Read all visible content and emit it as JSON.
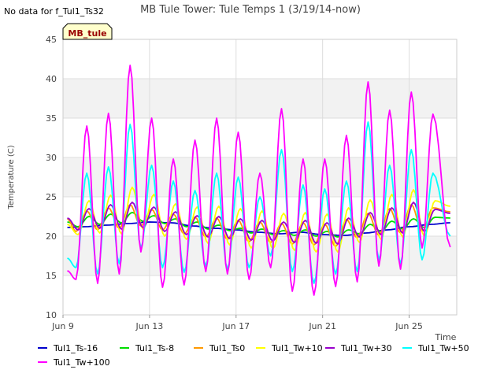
{
  "chart_data": {
    "type": "line",
    "title": "MB Tule Tower: Tule Temps 1 (3/19/14-now)",
    "no_data_note": "No data for f_Tul1_Ts32",
    "site_badge": "MB_tule",
    "xlabel": "Time",
    "ylabel": "Temperature (C)",
    "ylim": [
      10,
      45
    ],
    "yticks": [
      10,
      15,
      20,
      25,
      30,
      35,
      40,
      45
    ],
    "xlim": [
      9,
      27.2
    ],
    "xticks": [
      {
        "value": 9,
        "label": "Jun 9"
      },
      {
        "value": 13,
        "label": "Jun 13"
      },
      {
        "value": 17,
        "label": "Jun 17"
      },
      {
        "value": 21,
        "label": "Jun 21"
      },
      {
        "value": 25,
        "label": "Jun 25"
      }
    ],
    "grid": true,
    "legend": "bottom",
    "series": [
      {
        "name": "Tul1_Ts-16",
        "color": "#0000cc",
        "x": [
          9.2,
          10,
          11,
          12,
          13,
          14,
          15,
          16,
          17,
          18,
          19,
          20,
          21,
          22,
          23,
          24,
          25,
          26,
          26.9
        ],
        "y": [
          21.1,
          21.2,
          21.4,
          21.6,
          21.8,
          21.7,
          21.3,
          21.0,
          20.8,
          20.5,
          20.3,
          20.5,
          20.2,
          20.1,
          20.4,
          20.8,
          21.2,
          21.5,
          21.7
        ]
      },
      {
        "name": "Tul1_Ts-8",
        "color": "#00dd00",
        "x": [
          9.2,
          9.7,
          10.2,
          10.7,
          11.2,
          11.7,
          12.2,
          12.7,
          13.2,
          13.7,
          14.2,
          14.7,
          15.2,
          15.7,
          16.2,
          16.7,
          17.2,
          17.7,
          18.2,
          18.7,
          19.2,
          19.7,
          20.2,
          20.7,
          21.2,
          21.7,
          22.2,
          22.7,
          23.2,
          23.7,
          24.2,
          24.7,
          25.2,
          25.7,
          26.2,
          26.9
        ],
        "y": [
          21.8,
          21.2,
          22.5,
          21.5,
          22.8,
          21.7,
          23.0,
          21.9,
          22.6,
          21.6,
          22.2,
          21.2,
          21.8,
          20.9,
          21.4,
          20.7,
          21.0,
          20.4,
          20.9,
          20.2,
          20.7,
          20.1,
          20.8,
          20.0,
          20.6,
          19.9,
          20.8,
          20.3,
          21.5,
          20.6,
          21.9,
          20.9,
          22.2,
          21.1,
          22.4,
          22.3
        ]
      },
      {
        "name": "Tul1_Ts0",
        "color": "#ff9900",
        "x": [
          9.2,
          9.6,
          10.1,
          10.6,
          11.1,
          11.6,
          12.1,
          12.6,
          13.1,
          13.6,
          14.1,
          14.6,
          15.1,
          15.6,
          16.1,
          16.6,
          17.1,
          17.6,
          18.1,
          18.6,
          19.1,
          19.6,
          20.1,
          20.6,
          21.1,
          21.6,
          22.1,
          22.6,
          23.1,
          23.6,
          24.1,
          24.6,
          25.1,
          25.6,
          26.1,
          26.9
        ],
        "y": [
          22.2,
          20.6,
          23.2,
          20.8,
          23.6,
          21.0,
          24.0,
          21.3,
          23.4,
          20.8,
          22.8,
          20.3,
          22.4,
          19.9,
          22.3,
          19.6,
          22.0,
          19.3,
          21.8,
          19.2,
          21.6,
          19.0,
          21.7,
          18.9,
          21.5,
          18.7,
          22.1,
          19.8,
          22.9,
          20.1,
          23.5,
          20.4,
          24.0,
          20.6,
          23.6,
          23.1
        ]
      },
      {
        "name": "Tul1_Tw+10",
        "color": "#ffff00",
        "x": [
          9.2,
          9.7,
          10.2,
          10.7,
          11.2,
          11.7,
          12.2,
          12.7,
          13.2,
          13.7,
          14.2,
          14.7,
          15.2,
          15.7,
          16.2,
          16.7,
          17.2,
          17.7,
          18.2,
          18.7,
          19.2,
          19.7,
          20.2,
          20.7,
          21.2,
          21.7,
          22.2,
          22.7,
          23.2,
          23.7,
          24.2,
          24.7,
          25.2,
          25.7,
          26.2,
          26.9
        ],
        "y": [
          21.5,
          20.2,
          24.5,
          20.4,
          25.2,
          20.3,
          26.2,
          20.9,
          25.3,
          20.0,
          24.1,
          19.6,
          23.7,
          19.1,
          23.8,
          18.9,
          23.5,
          18.5,
          23.2,
          18.4,
          22.9,
          18.2,
          23.0,
          18.0,
          22.8,
          18.0,
          23.6,
          19.2,
          24.6,
          19.6,
          25.3,
          19.9,
          25.9,
          20.0,
          24.5,
          23.8
        ]
      },
      {
        "name": "Tul1_Tw+30",
        "color": "#9900cc",
        "x": [
          9.2,
          9.7,
          10.2,
          10.7,
          11.2,
          11.7,
          12.2,
          12.7,
          13.2,
          13.7,
          14.2,
          14.7,
          15.2,
          15.7,
          16.2,
          16.7,
          17.2,
          17.7,
          18.2,
          18.7,
          19.2,
          19.7,
          20.2,
          20.7,
          21.2,
          21.7,
          22.2,
          22.7,
          23.2,
          23.7,
          24.2,
          24.7,
          25.2,
          25.7,
          26.2,
          26.9
        ],
        "y": [
          22.3,
          20.8,
          23.5,
          21.0,
          24.0,
          20.9,
          24.3,
          21.1,
          23.7,
          20.6,
          23.1,
          20.2,
          22.6,
          19.9,
          22.5,
          19.7,
          22.2,
          19.5,
          22.0,
          19.4,
          21.8,
          19.2,
          22.0,
          19.1,
          21.7,
          19.0,
          22.3,
          19.9,
          23.0,
          20.2,
          23.6,
          20.4,
          24.3,
          20.6,
          23.4,
          22.9
        ]
      },
      {
        "name": "Tul1_Tw+50",
        "color": "#00ffff",
        "x": [
          9.2,
          9.6,
          10.1,
          10.6,
          11.1,
          11.6,
          12.1,
          12.6,
          13.1,
          13.6,
          14.1,
          14.6,
          15.1,
          15.6,
          16.1,
          16.6,
          17.1,
          17.6,
          18.1,
          18.6,
          19.1,
          19.6,
          20.1,
          20.6,
          21.1,
          21.6,
          22.1,
          22.6,
          23.1,
          23.6,
          24.1,
          24.6,
          25.1,
          25.6,
          26.1,
          26.9
        ],
        "y": [
          17.2,
          16.0,
          28.0,
          15.2,
          28.8,
          16.5,
          34.2,
          18.5,
          29.0,
          16.0,
          27.0,
          15.4,
          25.8,
          16.2,
          28.0,
          15.8,
          27.5,
          16.0,
          25.0,
          17.5,
          31.0,
          15.5,
          26.5,
          14.0,
          26.0,
          15.2,
          27.0,
          15.5,
          34.5,
          17.0,
          29.0,
          16.5,
          31.0,
          17.0,
          28.0,
          20.0
        ]
      },
      {
        "name": "Tul1_Tw+100",
        "color": "#ff00ff",
        "x": [
          9.2,
          9.6,
          10.1,
          10.6,
          11.1,
          11.6,
          12.1,
          12.6,
          13.1,
          13.6,
          14.1,
          14.6,
          15.1,
          15.6,
          16.1,
          16.6,
          17.1,
          17.6,
          18.1,
          18.6,
          19.1,
          19.6,
          20.1,
          20.6,
          21.1,
          21.6,
          22.1,
          22.6,
          23.1,
          23.6,
          24.1,
          24.6,
          25.1,
          25.6,
          26.1,
          26.9
        ],
        "y": [
          15.6,
          14.5,
          34.0,
          14.0,
          35.6,
          15.2,
          41.7,
          18.0,
          35.0,
          13.5,
          29.8,
          13.8,
          32.2,
          15.5,
          35.0,
          15.2,
          33.2,
          14.5,
          28.0,
          16.0,
          36.2,
          13.0,
          29.8,
          12.5,
          29.8,
          13.6,
          32.8,
          14.2,
          39.6,
          16.2,
          36.0,
          15.8,
          38.3,
          18.5,
          35.5,
          18.6
        ]
      }
    ]
  }
}
